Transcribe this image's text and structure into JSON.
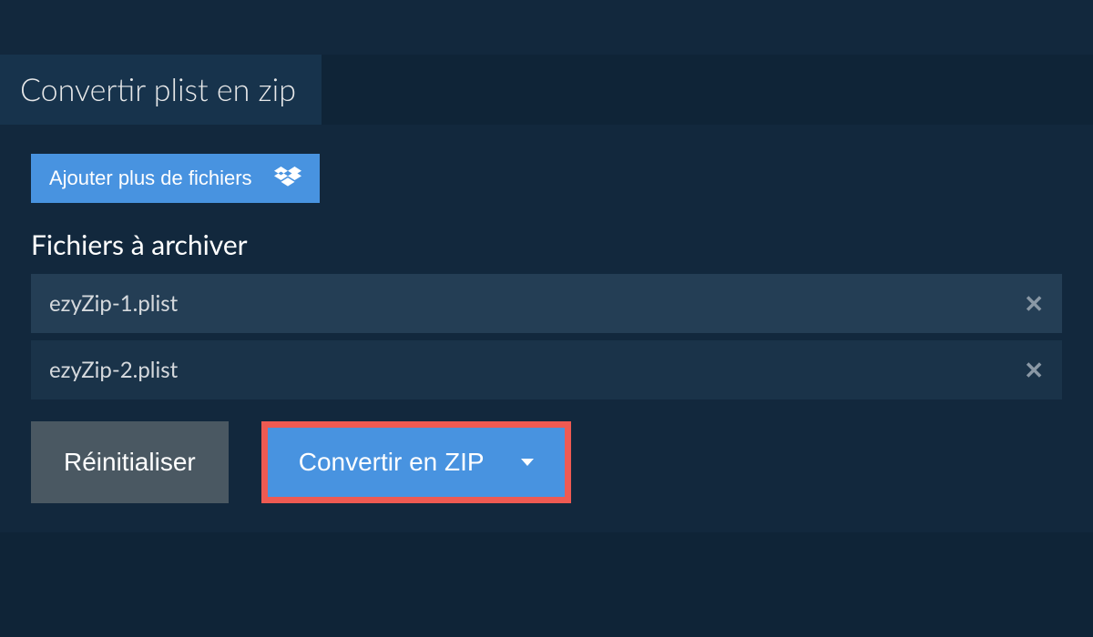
{
  "tab": {
    "title": "Convertir plist en zip"
  },
  "add_files": {
    "label": "Ajouter plus de fichiers"
  },
  "section": {
    "header": "Fichiers à archiver"
  },
  "files": [
    {
      "name": "ezyZip-1.plist"
    },
    {
      "name": "ezyZip-2.plist"
    }
  ],
  "actions": {
    "reset_label": "Réinitialiser",
    "convert_label": "Convertir en ZIP"
  },
  "colors": {
    "accent": "#4893e0",
    "highlight_border": "#ee5a52",
    "bg_dark": "#0f2437",
    "bg_panel": "#12283d",
    "bg_tab": "#17334c",
    "file_row": "#243e55",
    "file_row_alt": "#1a3349",
    "reset_btn": "#4a5862"
  }
}
